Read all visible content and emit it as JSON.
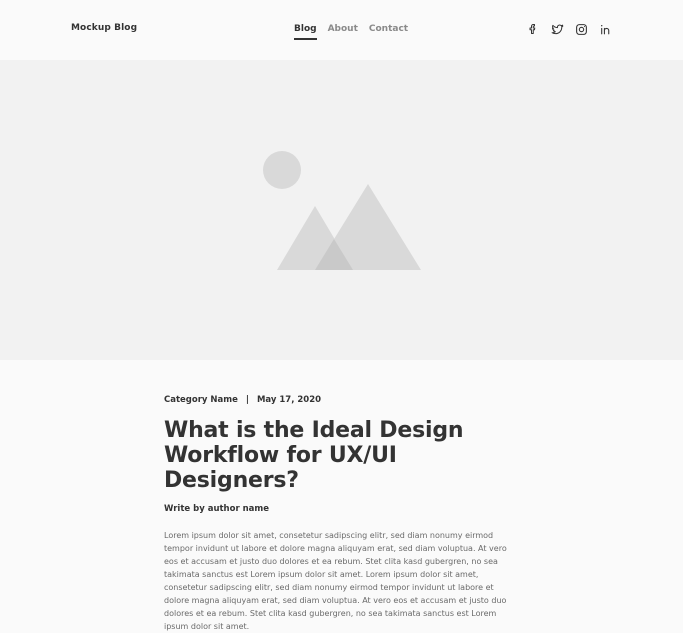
{
  "header": {
    "brand": "Mockup Blog",
    "nav": [
      {
        "label": "Blog",
        "active": true
      },
      {
        "label": "About",
        "active": false
      },
      {
        "label": "Contact",
        "active": false
      }
    ],
    "social": [
      "facebook-icon",
      "twitter-icon",
      "instagram-icon",
      "linkedin-icon"
    ]
  },
  "hero": {
    "image": "image-placeholder-icon",
    "background": "#f2f2f2",
    "shape_color": "#d9d9d9"
  },
  "article": {
    "category": "Category Name",
    "separator": "|",
    "date": "May 17, 2020",
    "title": "What is the Ideal Design Workflow for UX/UI Designers?",
    "author": "Write by author name",
    "body": "Lorem ipsum dolor sit amet, consetetur sadipscing elitr, sed diam nonumy eirmod tempor invidunt ut labore et dolore magna aliquyam erat, sed diam voluptua. At vero eos et accusam et justo duo dolores et ea rebum. Stet clita kasd gubergren, no sea takimata sanctus est Lorem ipsum dolor sit amet. Lorem ipsum dolor sit amet, consetetur sadipscing elitr, sed diam nonumy eirmod tempor invidunt ut labore et dolore magna aliquyam erat, sed diam voluptua. At vero eos et accusam et justo duo dolores et ea rebum. Stet clita kasd gubergren, no sea takimata sanctus est Lorem ipsum dolor sit amet."
  },
  "colors": {
    "page_background": "#fafafa",
    "text_primary": "#333333",
    "text_muted": "#8a8a8a"
  }
}
